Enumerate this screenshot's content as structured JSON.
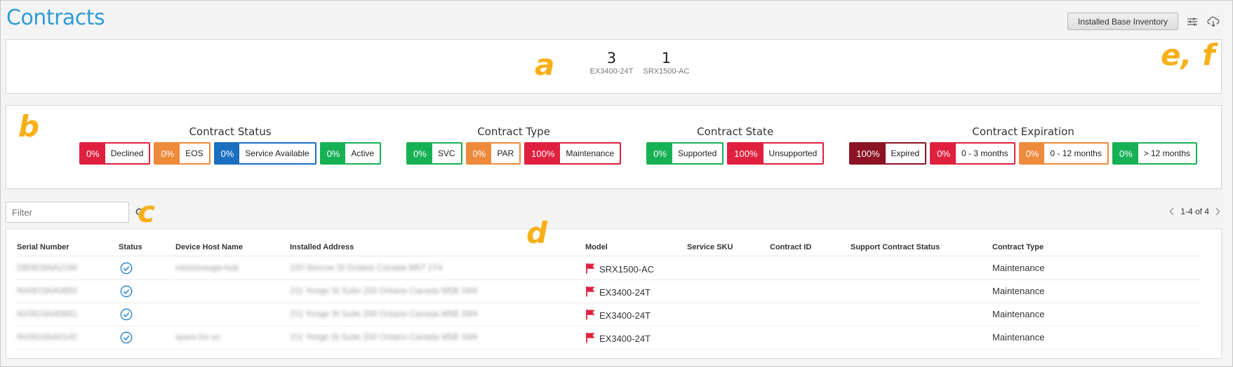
{
  "header": {
    "title": "Contracts",
    "inventory_button": "Installed Base Inventory",
    "settings_icon": "sliders-icon",
    "download_icon": "cloud-download-icon"
  },
  "markers": {
    "a": "a",
    "b": "b",
    "c": "c",
    "d": "d",
    "ef": "e, f"
  },
  "summary": [
    {
      "count": "3",
      "model": "EX3400-24T"
    },
    {
      "count": "1",
      "model": "SRX1500-AC"
    }
  ],
  "filter_groups": [
    {
      "title": "Contract Status",
      "chips": [
        {
          "pct": "0%",
          "label": "Declined",
          "color": "#e0203f"
        },
        {
          "pct": "0%",
          "label": "EOS",
          "color": "#ee8a3c"
        },
        {
          "pct": "0%",
          "label": "Service Available",
          "color": "#1c6fbf"
        },
        {
          "pct": "0%",
          "label": "Active",
          "color": "#17b155"
        }
      ]
    },
    {
      "title": "Contract Type",
      "chips": [
        {
          "pct": "0%",
          "label": "SVC",
          "color": "#17b155"
        },
        {
          "pct": "0%",
          "label": "PAR",
          "color": "#ee8a3c"
        },
        {
          "pct": "100%",
          "label": "Maintenance",
          "color": "#e0203f"
        }
      ]
    },
    {
      "title": "Contract State",
      "chips": [
        {
          "pct": "0%",
          "label": "Supported",
          "color": "#17b155"
        },
        {
          "pct": "100%",
          "label": "Unsupported",
          "color": "#e0203f"
        }
      ]
    },
    {
      "title": "Contract Expiration",
      "chips": [
        {
          "pct": "100%",
          "label": "Expired",
          "color": "#8b1323"
        },
        {
          "pct": "0%",
          "label": "0 - 3 months",
          "color": "#e0203f"
        },
        {
          "pct": "0%",
          "label": "0 - 12 months",
          "color": "#ee8a3c"
        },
        {
          "pct": "0%",
          "label": "> 12 months",
          "color": "#17b155"
        }
      ]
    }
  ],
  "filter": {
    "placeholder": "Filter"
  },
  "pagination": {
    "text": "1-4 of 4"
  },
  "table": {
    "columns": [
      "Serial Number",
      "Status",
      "Device Host Name",
      "Installed Address",
      "Model",
      "Service SKU",
      "Contract ID",
      "Support Contract Status",
      "Contract Type"
    ],
    "rows": [
      {
        "serial": "DB0816AA2190",
        "host": "mississauga-hub",
        "address": "220 Simcoe St Ontario Canada M5T 1T4",
        "model": "SRX1500-AC",
        "contract_type": "Maintenance"
      },
      {
        "serial": "NV0619AA0650",
        "host": "",
        "address": "211 Yonge St Suite 200 Ontario Canada M5B 1M4",
        "model": "EX3400-24T",
        "contract_type": "Maintenance"
      },
      {
        "serial": "NV0619AA0651",
        "host": "",
        "address": "211 Yonge St Suite 200 Ontario Canada M5B 1M4",
        "model": "EX3400-24T",
        "contract_type": "Maintenance"
      },
      {
        "serial": "NV0619AA0142",
        "host": "spare-for-sc",
        "address": "211 Yonge St Suite 200 Ontario Canada M5B 1M4",
        "model": "EX3400-24T",
        "contract_type": "Maintenance"
      }
    ]
  },
  "colors": {
    "accent": "#2f9bd6",
    "marker": "#f7b019",
    "flag": "#e0203f",
    "status_ok": "#1c7cc9"
  }
}
